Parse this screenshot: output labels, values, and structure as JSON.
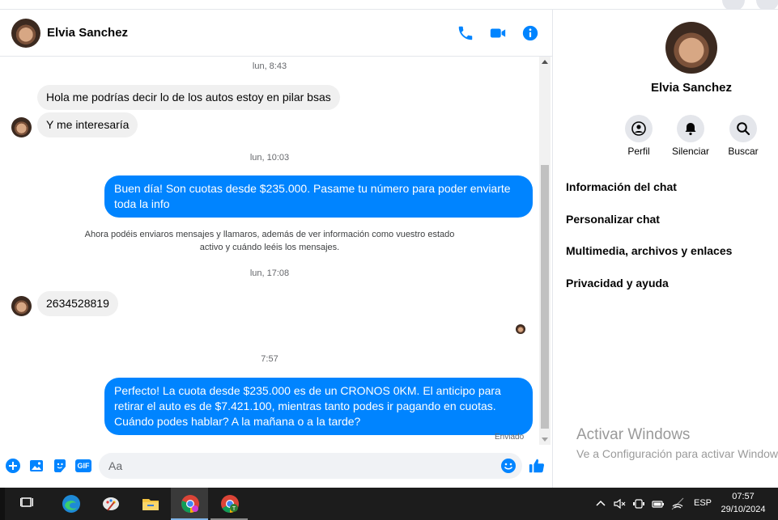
{
  "chat": {
    "contact_name": "Elvia Sanchez",
    "messages": [
      {
        "kind": "timestamp",
        "text": "lun, 8:43"
      },
      {
        "kind": "incoming",
        "text": "Hola me podrías decir lo de los autos estoy en pilar bsas"
      },
      {
        "kind": "incoming",
        "text": "Y me interesaría"
      },
      {
        "kind": "timestamp",
        "text": "lun, 10:03"
      },
      {
        "kind": "outgoing",
        "text": "Buen día! Son cuotas desde $235.000. Pasame tu número para poder enviarte toda la info"
      },
      {
        "kind": "notice",
        "text": "Ahora podéis enviaros mensajes y llamaros, además de ver información como vuestro estado activo y cuándo leéis los mensajes."
      },
      {
        "kind": "timestamp",
        "text": "lun, 17:08"
      },
      {
        "kind": "incoming",
        "text": "2634528819"
      },
      {
        "kind": "timestamp",
        "text": "7:57"
      },
      {
        "kind": "outgoing",
        "text": "Perfecto! La cuota desde $235.000 es de un CRONOS 0KM. El anticipo para retirar el auto es de $7.421.100, mientras tanto podes ir pagando en cuotas. Cuándo podes hablar? A la mañana o a la tarde?"
      }
    ],
    "sent_status": "Enviado",
    "composer_placeholder": "Aa",
    "composer_tools": {
      "gif_label": "GIF"
    }
  },
  "info_panel": {
    "name": "Elvia Sanchez",
    "actions": [
      {
        "label": "Perfil",
        "icon": "profile-icon"
      },
      {
        "label": "Silenciar",
        "icon": "bell-icon"
      },
      {
        "label": "Buscar",
        "icon": "search-icon"
      }
    ],
    "menu": [
      "Información del chat",
      "Personalizar chat",
      "Multimedia, archivos y enlaces",
      "Privacidad y ayuda"
    ],
    "watermark": {
      "title": "Activar Windows",
      "subtitle": "Ve a Configuración para activar Windows."
    }
  },
  "taskbar": {
    "apps": [
      "task-view-icon",
      "edge-icon",
      "paint-icon",
      "file-explorer-icon",
      "chrome-icon",
      "chrome-profile-icon"
    ],
    "language": "ESP",
    "time": "07:57",
    "date": "29/10/2024"
  },
  "colors": {
    "accent": "#0084ff",
    "incoming_bubble": "#f0f0f0",
    "taskbar": "#1c1c1c"
  }
}
